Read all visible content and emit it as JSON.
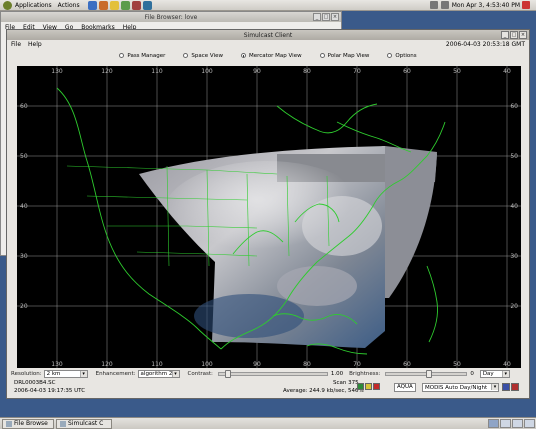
{
  "top_panel": {
    "menus": [
      "Applications",
      "Actions"
    ],
    "clock": "Mon Apr  3,  4:53:40 PM"
  },
  "file_browser": {
    "title": "File Browser: love",
    "menus": [
      "File",
      "Edit",
      "View",
      "Go",
      "Bookmarks",
      "Help"
    ]
  },
  "simulcast": {
    "title": "Simulcast Client",
    "menus": [
      "File",
      "Help"
    ],
    "timestamp": "2006-04-03 20:53:18 GMT",
    "views": [
      {
        "label": "Pass Manager",
        "selected": false
      },
      {
        "label": "Space View",
        "selected": false
      },
      {
        "label": "Mercator Map View",
        "selected": true
      },
      {
        "label": "Polar Map View",
        "selected": false
      },
      {
        "label": "Options",
        "selected": false
      }
    ],
    "map": {
      "lon_labels": [
        "130",
        "120",
        "110",
        "100",
        "90",
        "80",
        "70",
        "60",
        "50",
        "40"
      ],
      "lat_labels": [
        "60",
        "50",
        "40",
        "30",
        "20"
      ],
      "graticule_color": "#9a9a9a",
      "coastline_color": "#2ecc2e"
    },
    "controls": {
      "resolution_label": "Resolution:",
      "resolution_value": "2 km",
      "enhancement_label": "Enhancement:",
      "enhancement_value": "algorithm 2",
      "contrast_label": "Contrast:",
      "contrast_value": "1.00",
      "brightness_label": "Brightness:",
      "brightness_value": "0",
      "daynight_value": "Day"
    },
    "status": {
      "line1": "DRL0003B4.SC",
      "line2": "2006-04-03 19:17:35 UTC",
      "scan": "Scan 375",
      "average": "Average: 244.9 kb/sec, 546%",
      "satellite": "AQUA",
      "product": "MODIS Auto Day/Night"
    }
  },
  "taskbar": {
    "tasks": [
      "File Browse",
      "Simulcast C"
    ]
  }
}
